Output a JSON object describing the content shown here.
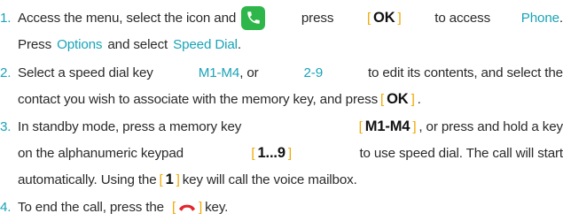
{
  "steps": [
    {
      "number": "1.",
      "l1a": "Access the menu, select the icon and",
      "l1b": "press",
      "l1c": "to access",
      "phone": "Phone",
      "period": ".",
      "key_ok": "OK",
      "l2a": "Press",
      "options": "Options",
      "l2b": "and select",
      "speed_dial": "Speed Dial",
      "l2c": "."
    },
    {
      "number": "2.",
      "l1a": "Select a speed dial key",
      "keys": "M1-M4",
      "l1b": ", or",
      "range": "2-9",
      "l1c": "to edit its contents, and select the",
      "l2a": "contact you wish to associate with the memory key, and press",
      "key_ok": "OK",
      "l2b": "."
    },
    {
      "number": "3.",
      "l1a": "In standby mode, press a memory key",
      "key_m": "M1-M4",
      "l1b": ", or press and hold a key",
      "l2a": "on the alphanumeric keypad",
      "key_range": "1...9",
      "l2b": "to use speed dial. The call will start",
      "l3a": "automatically. Using the",
      "key_one": "1",
      "l3b": "key will call the voice mailbox."
    },
    {
      "number": "4.",
      "l1a": "To end the call, press the",
      "l1b": "key."
    }
  ],
  "icons": {
    "phone_app": "phone-app-icon",
    "end_call": "end-call-icon"
  },
  "colors": {
    "accent": "#1aa3b8",
    "bracket": "#f0a800",
    "phone_icon_bg": "#2fb64a",
    "end_call": "#e0262c"
  }
}
